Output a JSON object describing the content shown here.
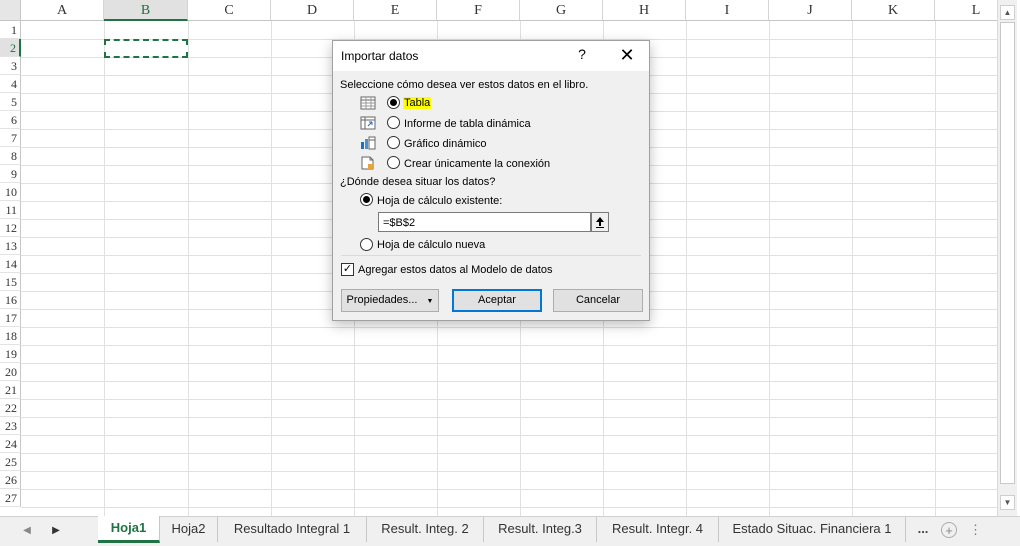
{
  "spreadsheet": {
    "columns": [
      "A",
      "B",
      "C",
      "D",
      "E",
      "F",
      "G",
      "H",
      "I",
      "J",
      "K",
      "L"
    ],
    "rows": [
      "1",
      "2",
      "3",
      "4",
      "5",
      "6",
      "7",
      "8",
      "9",
      "10",
      "11",
      "12",
      "13",
      "14",
      "15",
      "16",
      "17",
      "18",
      "19",
      "20",
      "21",
      "22",
      "23",
      "24",
      "25",
      "26",
      "27"
    ],
    "selected_column": "B",
    "selected_row": "2"
  },
  "dialog": {
    "title": "Importar datos",
    "help": "?",
    "close": "✕",
    "view_prompt": "Seleccione cómo desea ver estos datos en el libro.",
    "view_options": [
      {
        "label": "Tabla",
        "icon": "table-icon",
        "checked": true
      },
      {
        "label": "Informe de tabla dinámica",
        "icon": "pivot-table-icon",
        "checked": false
      },
      {
        "label": "Gráfico dinámico",
        "icon": "pivot-chart-icon",
        "checked": false
      },
      {
        "label": "Crear únicamente la conexión",
        "icon": "connection-icon",
        "checked": false
      }
    ],
    "location_prompt": "¿Dónde desea situar los datos?",
    "existing_sheet_label": "Hoja de cálculo existente:",
    "reference_value": "=$B$2",
    "new_sheet_label": "Hoja de cálculo nueva",
    "data_model_label": "Agregar estos datos al Modelo de datos",
    "properties_label": "Propiedades...",
    "accept_label": "Aceptar",
    "cancel_label": "Cancelar"
  },
  "sheet_tabs": {
    "tabs": [
      "Hoja1",
      "Hoja2",
      "Resultado Integral 1",
      "Result. Integ. 2",
      "Result. Integ.3",
      "Result. Integr. 4",
      "Estado Situac. Financiera 1"
    ],
    "active": "Hoja1",
    "more": "...",
    "add": "+",
    "options": "⋮"
  },
  "colors": {
    "accent": "#217346",
    "highlight": "#ffff00",
    "default_button_border": "#0078d7"
  }
}
